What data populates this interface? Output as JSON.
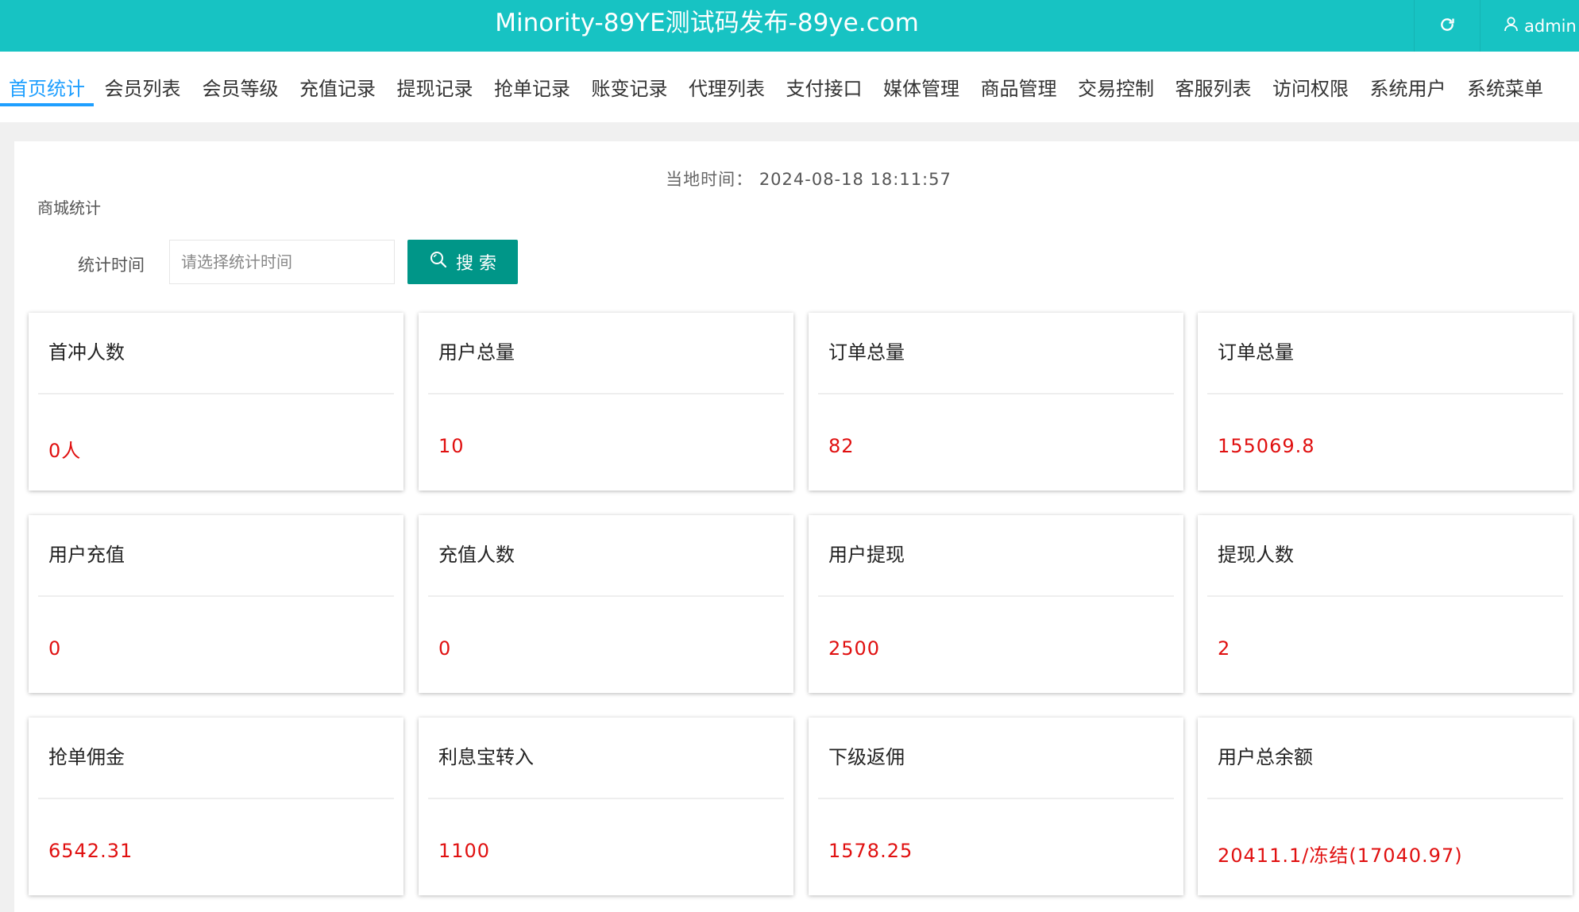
{
  "header": {
    "title": "Minority-89YE测试码发布-89ye.com",
    "user": "admin"
  },
  "tabs": [
    {
      "label": "首页统计",
      "active": true
    },
    {
      "label": "会员列表"
    },
    {
      "label": "会员等级"
    },
    {
      "label": "充值记录"
    },
    {
      "label": "提现记录"
    },
    {
      "label": "抢单记录"
    },
    {
      "label": "账变记录"
    },
    {
      "label": "代理列表"
    },
    {
      "label": "支付接口"
    },
    {
      "label": "媒体管理"
    },
    {
      "label": "商品管理"
    },
    {
      "label": "交易控制"
    },
    {
      "label": "客服列表"
    },
    {
      "label": "访问权限"
    },
    {
      "label": "系统用户"
    },
    {
      "label": "系统菜单"
    }
  ],
  "main": {
    "local_time_label": "当地时间：",
    "local_time_value": "2024-08-18 18:11:57",
    "section_title": "商城统计",
    "filter": {
      "label": "统计时间",
      "placeholder": "请选择统计时间",
      "search_label": "搜 索"
    },
    "cards": [
      {
        "title": "首冲人数",
        "value": "0人"
      },
      {
        "title": "用户总量",
        "value": "10"
      },
      {
        "title": "订单总量",
        "value": "82"
      },
      {
        "title": "订单总量",
        "value": "155069.8"
      },
      {
        "title": "用户充值",
        "value": "0"
      },
      {
        "title": "充值人数",
        "value": "0"
      },
      {
        "title": "用户提现",
        "value": "2500"
      },
      {
        "title": "提现人数",
        "value": "2"
      },
      {
        "title": "抢单佣金",
        "value": "6542.31"
      },
      {
        "title": "利息宝转入",
        "value": "1100"
      },
      {
        "title": "下级返佣",
        "value": "1578.25"
      },
      {
        "title": "用户总余额",
        "value": "20411.1/冻结(17040.97)"
      }
    ]
  },
  "colors": {
    "header_bg": "#17c3c3",
    "tab_active": "#1e9fff",
    "search_button": "#009688",
    "value_text": "#e01010"
  },
  "icons": {
    "refresh": "refresh-icon",
    "user": "user-icon",
    "search": "search-icon"
  }
}
